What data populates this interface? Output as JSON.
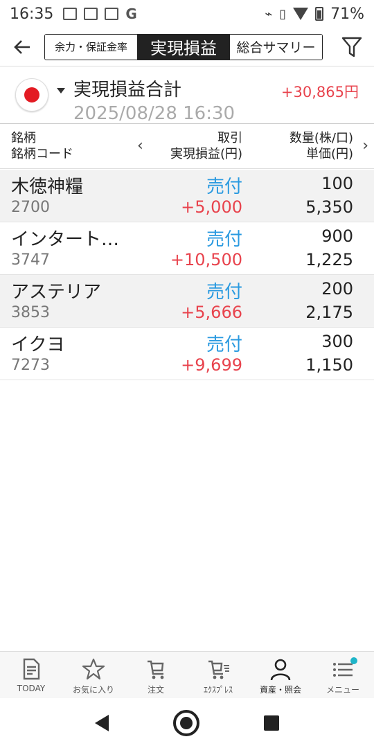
{
  "status_bar": {
    "time": "16:35",
    "g_label": "G",
    "battery": "71%"
  },
  "header": {
    "tabs": [
      "余力・保証金率",
      "実現損益",
      "総合サマリー"
    ],
    "active_tab": "実現損益"
  },
  "summary": {
    "title": "実現損益合計",
    "total": "+30,865円",
    "timestamp": "2025/08/28 16:30"
  },
  "columns": {
    "col1_line1": "銘柄",
    "col1_line2": "銘柄コード",
    "col2_line1": "取引",
    "col2_line2": "実現損益(円)",
    "col3_line1": "数量(株/口)",
    "col3_line2": "単価(円)"
  },
  "rows": [
    {
      "name": "木徳神糧",
      "code": "2700",
      "trade": "売付",
      "pnl": "+5,000",
      "qty": "100",
      "price": "5,350"
    },
    {
      "name": "インタートレード",
      "code": "3747",
      "trade": "売付",
      "pnl": "+10,500",
      "qty": "900",
      "price": "1,225"
    },
    {
      "name": "アステリア",
      "code": "3853",
      "trade": "売付",
      "pnl": "+5,666",
      "qty": "200",
      "price": "2,175"
    },
    {
      "name": "イクヨ",
      "code": "7273",
      "trade": "売付",
      "pnl": "+9,699",
      "qty": "300",
      "price": "1,150"
    }
  ],
  "bottom_nav": [
    {
      "label": "TODAY",
      "icon": "document-icon"
    },
    {
      "label": "お気に入り",
      "icon": "star-icon"
    },
    {
      "label": "注文",
      "icon": "cart-icon"
    },
    {
      "label": "ｴｸｽﾌﾟﾚｽ",
      "icon": "express-cart-icon"
    },
    {
      "label": "資産・照会",
      "icon": "person-icon"
    },
    {
      "label": "メニュー",
      "icon": "menu-icon"
    }
  ],
  "colors": {
    "positive": "#e8434d",
    "sell": "#2a9ae0",
    "active_tab_bg": "#222222",
    "notification_dot": "#1fb5c9"
  }
}
